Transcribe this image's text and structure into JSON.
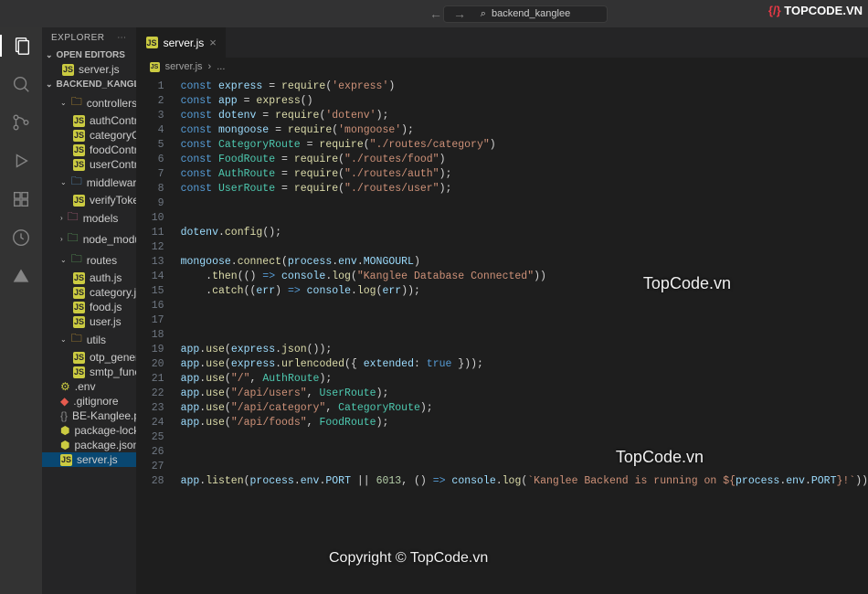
{
  "titlebar": {
    "search_text": "backend_kanglee",
    "brand": "TOPCODE.VN"
  },
  "explorer": {
    "title": "EXPLORER",
    "open_editors": "OPEN EDITORS",
    "open_editor_file": "server.js",
    "project": "BACKEND_KANGLEE",
    "tree": [
      {
        "type": "folder",
        "name": "controllers",
        "depth": 1,
        "iconClass": "ic-folder-r",
        "open": true
      },
      {
        "type": "file",
        "name": "authController.js",
        "depth": 2,
        "icon": "JS"
      },
      {
        "type": "file",
        "name": "categoryController.js",
        "depth": 2,
        "icon": "JS"
      },
      {
        "type": "file",
        "name": "foodController.js",
        "depth": 2,
        "icon": "JS"
      },
      {
        "type": "file",
        "name": "userController.js",
        "depth": 2,
        "icon": "JS"
      },
      {
        "type": "folder",
        "name": "middleware",
        "depth": 1,
        "iconClass": "ic-folder-b",
        "open": true
      },
      {
        "type": "file",
        "name": "verifyToken.js",
        "depth": 2,
        "icon": "JS"
      },
      {
        "type": "folder",
        "name": "models",
        "depth": 1,
        "iconClass": "ic-folder-p",
        "open": false
      },
      {
        "type": "folder",
        "name": "node_modules",
        "depth": 1,
        "iconClass": "ic-folder-g",
        "open": false
      },
      {
        "type": "folder",
        "name": "routes",
        "depth": 1,
        "iconClass": "ic-folder-g",
        "open": true
      },
      {
        "type": "file",
        "name": "auth.js",
        "depth": 2,
        "icon": "JS"
      },
      {
        "type": "file",
        "name": "category.js",
        "depth": 2,
        "icon": "JS"
      },
      {
        "type": "file",
        "name": "food.js",
        "depth": 2,
        "icon": "JS"
      },
      {
        "type": "file",
        "name": "user.js",
        "depth": 2,
        "icon": "JS"
      },
      {
        "type": "folder",
        "name": "utils",
        "depth": 1,
        "iconClass": "ic-folder-r",
        "open": true
      },
      {
        "type": "file",
        "name": "otp_generator.js",
        "depth": 2,
        "icon": "JS"
      },
      {
        "type": "file",
        "name": "smtp_function.js",
        "depth": 2,
        "icon": "JS"
      },
      {
        "type": "file",
        "name": ".env",
        "depth": 1,
        "iconClass": "ic-env",
        "glyph": "⚙"
      },
      {
        "type": "file",
        "name": ".gitignore",
        "depth": 1,
        "iconClass": "ic-git",
        "glyph": "◆"
      },
      {
        "type": "file",
        "name": "BE-Kanglee.postman_collecti...",
        "depth": 1,
        "iconClass": "ic-postman",
        "glyph": "{}"
      },
      {
        "type": "file",
        "name": "package-lock.json",
        "depth": 1,
        "iconClass": "ic-json",
        "glyph": "⬢"
      },
      {
        "type": "file",
        "name": "package.json",
        "depth": 1,
        "iconClass": "ic-json",
        "glyph": "⬢"
      },
      {
        "type": "file",
        "name": "server.js",
        "depth": 1,
        "icon": "JS",
        "selected": true
      }
    ]
  },
  "tab": {
    "label": "server.js"
  },
  "breadcrumb": {
    "file": "server.js",
    "sep": "›",
    "rest": "..."
  },
  "code_lines": [
    "<span class='kw'>const</span> <span class='prop'>express</span> = <span class='fn'>require</span>(<span class='str'>'express'</span>)",
    "<span class='kw'>const</span> <span class='prop'>app</span> = <span class='fn'>express</span>()",
    "<span class='kw'>const</span> <span class='prop'>dotenv</span> = <span class='fn'>require</span>(<span class='str'>'dotenv'</span>);",
    "<span class='kw'>const</span> <span class='prop'>mongoose</span> = <span class='fn'>require</span>(<span class='str'>'mongoose'</span>);",
    "<span class='kw'>const</span> <span class='cls'>CategoryRoute</span> = <span class='fn'>require</span>(<span class='str'>\"./routes/category\"</span>)",
    "<span class='kw'>const</span> <span class='cls'>FoodRoute</span> = <span class='fn'>require</span>(<span class='str'>\"./routes/food\"</span>)",
    "<span class='kw'>const</span> <span class='cls'>AuthRoute</span> = <span class='fn'>require</span>(<span class='str'>\"./routes/auth\"</span>);",
    "<span class='kw'>const</span> <span class='cls'>UserRoute</span> = <span class='fn'>require</span>(<span class='str'>\"./routes/user\"</span>);",
    "",
    "",
    "<span class='prop'>dotenv</span>.<span class='fn'>config</span>();",
    "",
    "<span class='prop'>mongoose</span>.<span class='fn'>connect</span>(<span class='prop'>process</span>.<span class='prop'>env</span>.<span class='prop'>MONGOURL</span>)",
    "    .<span class='fn'>then</span>(() <span class='kw'>=&gt;</span> <span class='prop'>console</span>.<span class='fn'>log</span>(<span class='str'>\"Kanglee Database Connected\"</span>))",
    "    .<span class='fn'>catch</span>((<span class='param'>err</span>) <span class='kw'>=&gt;</span> <span class='prop'>console</span>.<span class='fn'>log</span>(<span class='param'>err</span>));",
    "",
    "",
    "",
    "<span class='prop'>app</span>.<span class='fn'>use</span>(<span class='prop'>express</span>.<span class='fn'>json</span>());",
    "<span class='prop'>app</span>.<span class='fn'>use</span>(<span class='prop'>express</span>.<span class='fn'>urlencoded</span>({ <span class='prop'>extended</span>: <span class='kw'>true</span> }));",
    "<span class='prop'>app</span>.<span class='fn'>use</span>(<span class='str'>\"/\"</span>, <span class='cls'>AuthRoute</span>);",
    "<span class='prop'>app</span>.<span class='fn'>use</span>(<span class='str'>\"/api/users\"</span>, <span class='cls'>UserRoute</span>);",
    "<span class='prop'>app</span>.<span class='fn'>use</span>(<span class='str'>\"/api/category\"</span>, <span class='cls'>CategoryRoute</span>);",
    "<span class='prop'>app</span>.<span class='fn'>use</span>(<span class='str'>\"/api/foods\"</span>, <span class='cls'>FoodRoute</span>);",
    "",
    "",
    "",
    "<span class='prop'>app</span>.<span class='fn'>listen</span>(<span class='prop'>process</span>.<span class='prop'>env</span>.<span class='prop'>PORT</span> || <span class='num'>6013</span>, () <span class='kw'>=&gt;</span> <span class='prop'>console</span>.<span class='fn'>log</span>(<span class='str'>`Kanglee Backend is running on ${</span><span class='prop'>process</span>.<span class='prop'>env</span>.<span class='prop'>PORT</span><span class='str'>}!`</span>))"
  ],
  "watermarks": {
    "wm1": "TopCode.vn",
    "wm2": "TopCode.vn",
    "wm3": "Copyright © TopCode.vn"
  }
}
